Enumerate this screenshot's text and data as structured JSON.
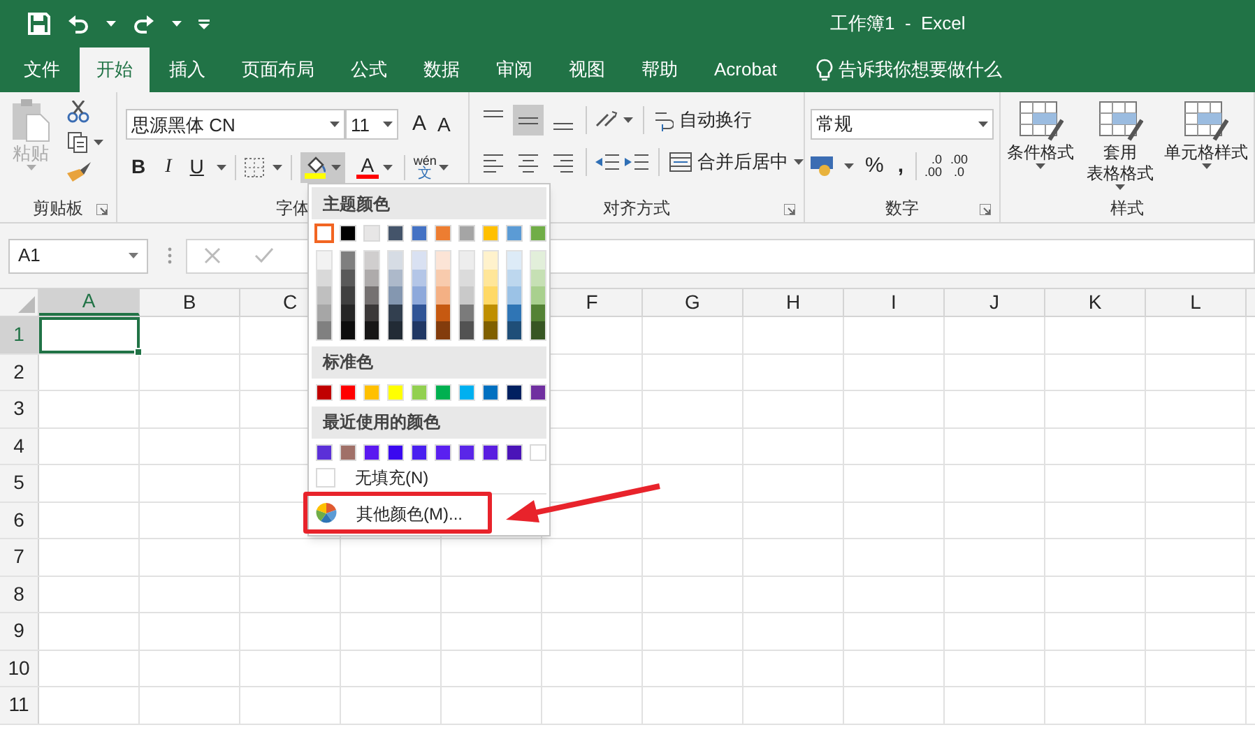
{
  "title_bar": {
    "title": "工作簿1  -  Excel"
  },
  "tabs": [
    {
      "label": "文件",
      "selected": false
    },
    {
      "label": "开始",
      "selected": true
    },
    {
      "label": "插入",
      "selected": false
    },
    {
      "label": "页面布局",
      "selected": false
    },
    {
      "label": "公式",
      "selected": false
    },
    {
      "label": "数据",
      "selected": false
    },
    {
      "label": "审阅",
      "selected": false
    },
    {
      "label": "视图",
      "selected": false
    },
    {
      "label": "帮助",
      "selected": false
    },
    {
      "label": "Acrobat",
      "selected": false
    }
  ],
  "search": {
    "placeholder": "告诉我你想要做什么"
  },
  "ribbon": {
    "clipboard": {
      "paste": "粘贴",
      "label": "剪贴板"
    },
    "font": {
      "font_name": "思源黑体 CN",
      "font_size": "11",
      "grow": "A",
      "shrink": "A",
      "bold": "B",
      "italic": "I",
      "underline": "U",
      "fill_button": {
        "color": "#ffff00",
        "open": true
      },
      "font_color": {
        "letter": "A",
        "color": "#ff0000"
      },
      "phonetic": "wén",
      "phonetic_char": "文",
      "label": "字体"
    },
    "alignment": {
      "vertical_align": [
        {
          "selected": false
        },
        {
          "selected": true
        },
        {
          "selected": false
        }
      ],
      "wrap": "自动换行",
      "merge": "合并后居中",
      "label": "对齐方式"
    },
    "number": {
      "format": "常规",
      "percent": "%",
      "comma": ",",
      "decimal_increase": {
        "top": ".0",
        "bottom": ".00"
      },
      "decimal_decrease": {
        "top": ".00",
        "bottom": ".0"
      },
      "label": "数字"
    },
    "styles": {
      "conditional": "条件格式",
      "table_format": [
        "套用",
        "表格格式"
      ],
      "cell_styles": "单元格样式",
      "label": "样式"
    }
  },
  "formula_bar": {
    "name_box": "A1"
  },
  "sheet": {
    "columns": [
      {
        "label": "A",
        "selected": true
      },
      {
        "label": "B",
        "selected": false
      },
      {
        "label": "C",
        "selected": false
      },
      {
        "label": "F",
        "selected": false
      },
      {
        "label": "G",
        "selected": false
      },
      {
        "label": "H",
        "selected": false
      },
      {
        "label": "I",
        "selected": false
      },
      {
        "label": "J",
        "selected": false
      },
      {
        "label": "K",
        "selected": false
      },
      {
        "label": "L",
        "selected": false
      }
    ],
    "rows": [
      {
        "label": "1",
        "selected": true
      },
      {
        "label": "2",
        "selected": false
      },
      {
        "label": "3",
        "selected": false
      },
      {
        "label": "4",
        "selected": false
      },
      {
        "label": "5",
        "selected": false
      },
      {
        "label": "6",
        "selected": false
      },
      {
        "label": "7",
        "selected": false
      },
      {
        "label": "8",
        "selected": false
      },
      {
        "label": "9",
        "selected": false
      },
      {
        "label": "10",
        "selected": false
      },
      {
        "label": "11",
        "selected": false
      }
    ]
  },
  "fill_menu": {
    "theme_title": "主题颜色",
    "theme_colors": [
      {
        "color": "#ffffff",
        "selected": true,
        "shades": [
          {
            "color": "#f2f2f2"
          },
          {
            "color": "#d9d9d9"
          },
          {
            "color": "#bfbfbf"
          },
          {
            "color": "#a6a6a6"
          },
          {
            "color": "#808080"
          }
        ]
      },
      {
        "color": "#000000",
        "selected": false,
        "shades": [
          {
            "color": "#7f7f7f"
          },
          {
            "color": "#595959"
          },
          {
            "color": "#404040"
          },
          {
            "color": "#262626"
          },
          {
            "color": "#0d0d0d"
          }
        ]
      },
      {
        "color": "#e7e6e6",
        "selected": false,
        "shades": [
          {
            "color": "#d0cece"
          },
          {
            "color": "#aeabab"
          },
          {
            "color": "#757171"
          },
          {
            "color": "#3b3838"
          },
          {
            "color": "#171616"
          }
        ]
      },
      {
        "color": "#44546a",
        "selected": false,
        "shades": [
          {
            "color": "#d6dce4"
          },
          {
            "color": "#adb9ca"
          },
          {
            "color": "#8497b0"
          },
          {
            "color": "#323f4f"
          },
          {
            "color": "#222b35"
          }
        ]
      },
      {
        "color": "#4472c4",
        "selected": false,
        "shades": [
          {
            "color": "#d9e1f2"
          },
          {
            "color": "#b4c6e7"
          },
          {
            "color": "#8ea9db"
          },
          {
            "color": "#305496"
          },
          {
            "color": "#203764"
          }
        ]
      },
      {
        "color": "#ed7d31",
        "selected": false,
        "shades": [
          {
            "color": "#fce4d6"
          },
          {
            "color": "#f8cbad"
          },
          {
            "color": "#f4b084"
          },
          {
            "color": "#c65911"
          },
          {
            "color": "#833c0c"
          }
        ]
      },
      {
        "color": "#a5a5a5",
        "selected": false,
        "shades": [
          {
            "color": "#ededed"
          },
          {
            "color": "#dbdbdb"
          },
          {
            "color": "#c9c9c9"
          },
          {
            "color": "#7b7b7b"
          },
          {
            "color": "#525252"
          }
        ]
      },
      {
        "color": "#ffc000",
        "selected": false,
        "shades": [
          {
            "color": "#fff2cc"
          },
          {
            "color": "#ffe699"
          },
          {
            "color": "#ffd966"
          },
          {
            "color": "#bf8f00"
          },
          {
            "color": "#806000"
          }
        ]
      },
      {
        "color": "#5b9bd5",
        "selected": false,
        "shades": [
          {
            "color": "#ddebf7"
          },
          {
            "color": "#bdd7ee"
          },
          {
            "color": "#9bc2e6"
          },
          {
            "color": "#2f75b5"
          },
          {
            "color": "#1f4e78"
          }
        ]
      },
      {
        "color": "#70ad47",
        "selected": false,
        "shades": [
          {
            "color": "#e2efda"
          },
          {
            "color": "#c6e0b4"
          },
          {
            "color": "#a9d08e"
          },
          {
            "color": "#548235"
          },
          {
            "color": "#375623"
          }
        ]
      }
    ],
    "standard_title": "标准色",
    "standard_colors": [
      {
        "color": "#c00000"
      },
      {
        "color": "#ff0000"
      },
      {
        "color": "#ffc000"
      },
      {
        "color": "#ffff00"
      },
      {
        "color": "#92d050"
      },
      {
        "color": "#00b050"
      },
      {
        "color": "#00b0f0"
      },
      {
        "color": "#0070c0"
      },
      {
        "color": "#002060"
      },
      {
        "color": "#7030a0"
      }
    ],
    "recent_title": "最近使用的颜色",
    "recent_colors": [
      {
        "color": "#5b30d8"
      },
      {
        "color": "#a07068"
      },
      {
        "color": "#5a18f0"
      },
      {
        "color": "#3a08f0"
      },
      {
        "color": "#4a20f0"
      },
      {
        "color": "#5a20f0"
      },
      {
        "color": "#5a26e8"
      },
      {
        "color": "#5a1ee0"
      },
      {
        "color": "#4a14b8"
      },
      {
        "color": "#ffffff"
      }
    ],
    "no_fill": "无填充(N)",
    "more_colors": "其他颜色(M)..."
  },
  "annotations": [
    {
      "kind": "box"
    },
    {
      "kind": "arrow"
    }
  ]
}
